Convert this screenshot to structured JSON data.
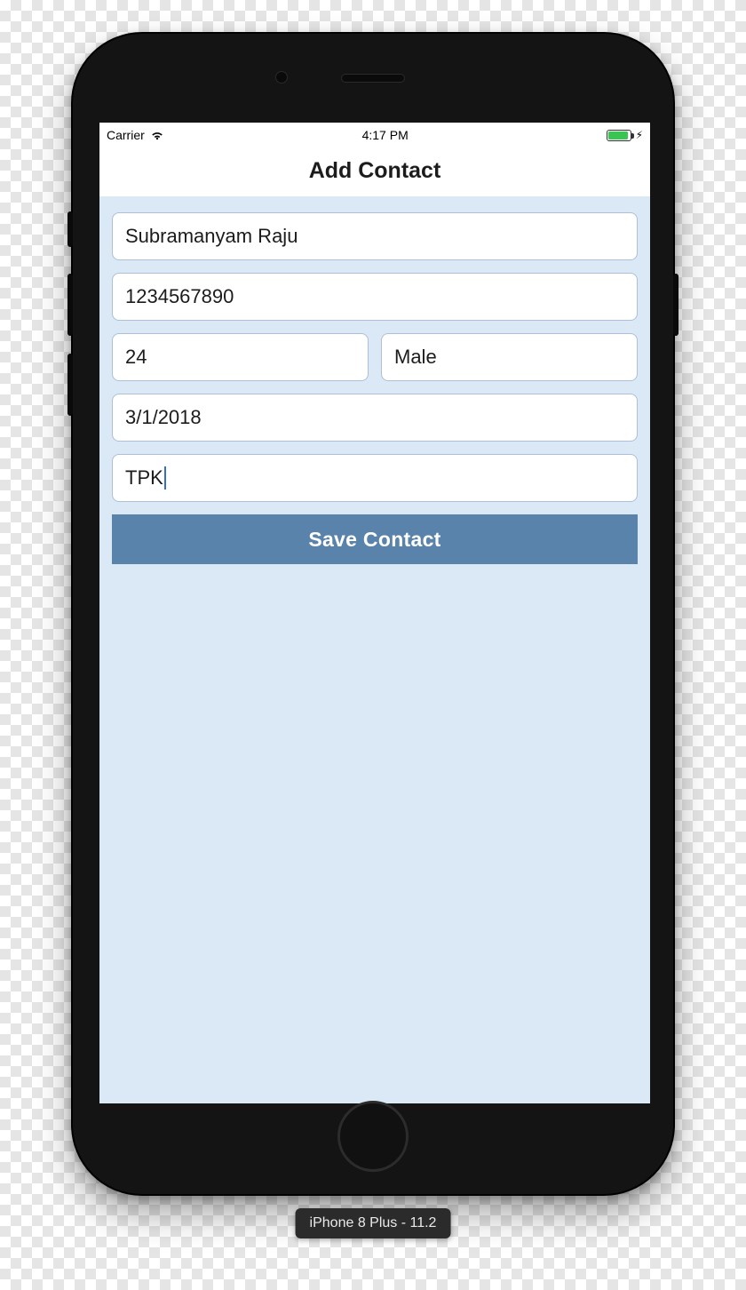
{
  "status_bar": {
    "carrier": "Carrier",
    "time": "4:17 PM"
  },
  "header": {
    "title": "Add Contact"
  },
  "form": {
    "name_value": "Subramanyam Raju",
    "phone_value": "1234567890",
    "age_value": "24",
    "gender_value": "Male",
    "date_value": "3/1/2018",
    "location_value": "TPK",
    "save_label": "Save Contact"
  },
  "device_badge": "iPhone 8 Plus - 11.2"
}
